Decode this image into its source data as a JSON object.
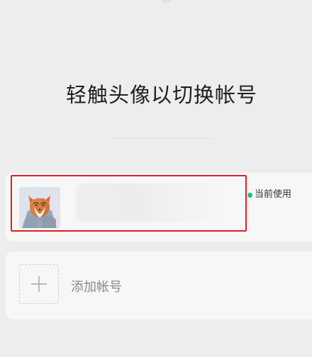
{
  "header": {
    "title": "轻触头像以切换帐号"
  },
  "current_account": {
    "status_label": "当前使用",
    "status_color": "#14C37F"
  },
  "add_account": {
    "label": "添加帐号",
    "icon": "plus-icon"
  },
  "highlight": {
    "color": "#E11D24"
  },
  "avatar": {
    "icon": "fox-avatar"
  }
}
